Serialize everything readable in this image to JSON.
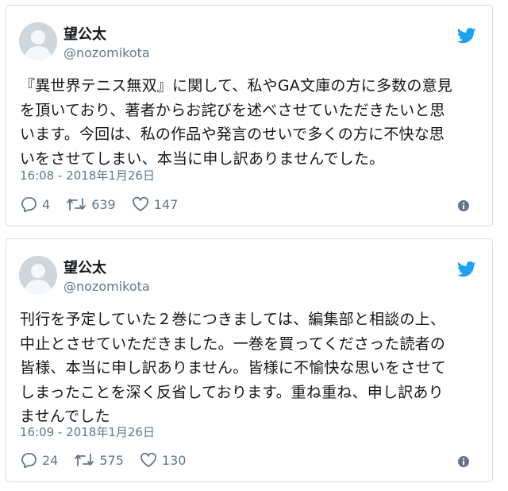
{
  "colors": {
    "twitter_blue": "#1da1f2",
    "muted": "#657786",
    "text": "#14171a"
  },
  "tweets": [
    {
      "name": "望公太",
      "handle": "@nozomikota",
      "text": "『異世界テニス無双』に関して、私やGA文庫の方に多数の意見\nを頂いており、著者からお詫びを述べさせていただきたいと思\nいます。今回は、私の作品や発言のせいで多くの方に不快な思\nいをさせてしまい、本当に申し訳ありませんでした。",
      "timestamp": "16:08 - 2018年1月26日",
      "replies": "4",
      "retweets": "639",
      "likes": "147",
      "icons": [
        "avatar",
        "twitter-bird-icon",
        "reply-icon",
        "retweet-icon",
        "like-icon",
        "info-icon"
      ]
    },
    {
      "name": "望公太",
      "handle": "@nozomikota",
      "text": "刊行を予定していた２巻につきましては、編集部と相談の上、\n中止とさせていただきました。一巻を買ってくださった読者の\n皆様、本当に申し訳ありません。皆様に不愉快な思いをさせて\nしまったことを深く反省しております。重ね重ね、申し訳あり\nませんでした",
      "timestamp": "16:09 - 2018年1月26日",
      "replies": "24",
      "retweets": "575",
      "likes": "130",
      "icons": [
        "avatar",
        "twitter-bird-icon",
        "reply-icon",
        "retweet-icon",
        "like-icon",
        "info-icon"
      ]
    }
  ]
}
